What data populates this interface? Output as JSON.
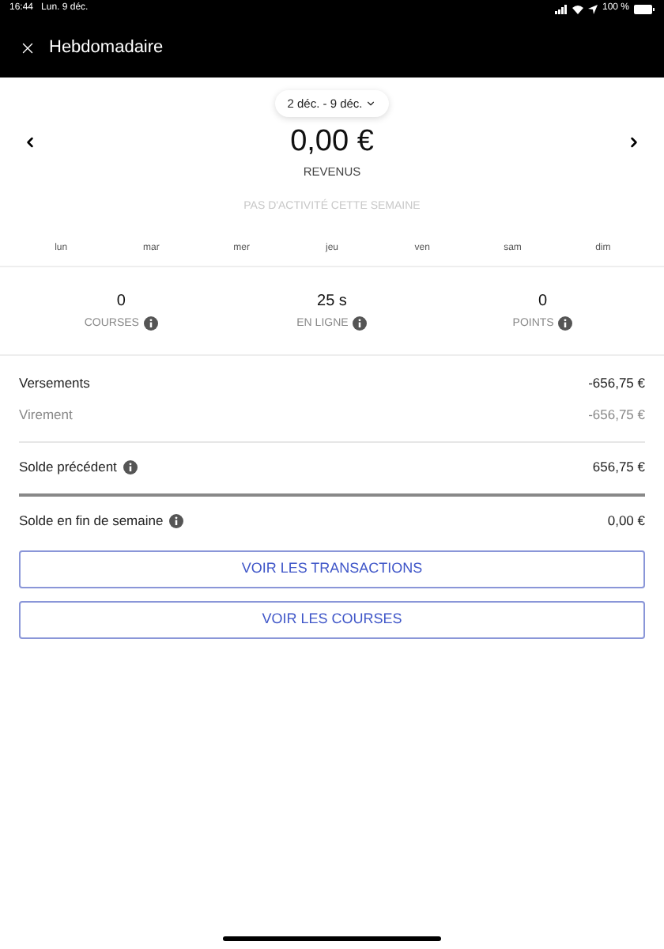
{
  "status_bar": {
    "time": "16:44",
    "date": "Lun. 9 déc.",
    "battery": "100 %"
  },
  "header": {
    "title": "Hebdomadaire"
  },
  "week_picker": {
    "label": "2 déc. - 9 déc."
  },
  "summary": {
    "amount": "0,00 €",
    "label": "REVENUS",
    "note": "PAS D'ACTIVITÉ CETTE SEMAINE"
  },
  "days": [
    "lun",
    "mar",
    "mer",
    "jeu",
    "ven",
    "sam",
    "dim"
  ],
  "stats": [
    {
      "value": "0",
      "label": "COURSES"
    },
    {
      "value": "25 s",
      "label": "EN LIGNE"
    },
    {
      "value": "0",
      "label": "POINTS"
    }
  ],
  "payouts": [
    {
      "kind": "main",
      "label": "Versements",
      "amount": "-656,75 €",
      "info": false
    },
    {
      "kind": "detail",
      "label": "Virement",
      "amount": "-656,75 €",
      "info": false
    }
  ],
  "previous_balance": {
    "label": "Solde précédent",
    "amount": "656,75 €",
    "info": true
  },
  "end_balance": {
    "label": "Solde en fin de semaine",
    "amount": "0,00 €",
    "info": true
  },
  "buttons": [
    "VOIR LES TRANSACTIONS",
    "VOIR LES COURSES"
  ]
}
